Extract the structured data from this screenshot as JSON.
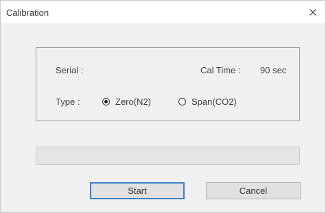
{
  "window": {
    "title": "Calibration"
  },
  "group": {
    "serial_label": "Serial :",
    "cal_time_label": "Cal Time :",
    "cal_time_value": "90 sec",
    "type_label": "Type  :",
    "radio_zero_label": "Zero(N2)",
    "radio_span_label": "Span(CO2)",
    "selected": "zero"
  },
  "progress": {
    "value": 0
  },
  "buttons": {
    "start_label": "Start",
    "cancel_label": "Cancel"
  },
  "icons": {
    "close": "close-icon"
  }
}
